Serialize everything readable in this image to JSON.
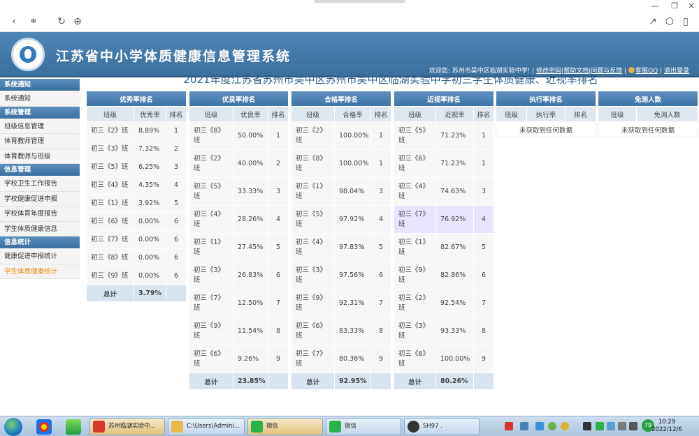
{
  "app": {
    "title": "江苏省中小学体质健康信息管理系统",
    "welcome": "欢迎您: 苏州市吴中区临湖实验中学!",
    "links": [
      "修改密码",
      "帮助文档",
      "问题与反馈",
      "客服QQ",
      "退出登录"
    ]
  },
  "sidebar": {
    "sections": [
      {
        "title": "系统通知",
        "items": [
          "系统通知"
        ]
      },
      {
        "title": "系统管理",
        "items": [
          "班级信息管理",
          "体育教师管理",
          "体育教师与班级"
        ]
      },
      {
        "title": "信息管理",
        "items": [
          "学校卫生工作报告",
          "学校健康促进申报",
          "学校体育年度报告",
          "学生体质健康信息"
        ]
      },
      {
        "title": "信息统计",
        "items": [
          "健康促进申报统计",
          "学生体质健康统计"
        ]
      }
    ],
    "active_item": "学生体质健康统计"
  },
  "page": {
    "heading": "2021年度江苏省苏州市吴中区苏州市吴中区临湖实验中学初三学生体质健康、近视率排名"
  },
  "tables": {
    "excellent": {
      "title": "优秀率排名",
      "columns": [
        "班级",
        "优秀率",
        "排名"
      ],
      "rows": [
        [
          "初三《2》班",
          "8.89%",
          "1"
        ],
        [
          "初三《3》班",
          "7.32%",
          "2"
        ],
        [
          "初三《5》班",
          "6.25%",
          "3"
        ],
        [
          "初三《4》班",
          "4.35%",
          "4"
        ],
        [
          "初三《1》班",
          "3.92%",
          "5"
        ],
        [
          "初三《6》班",
          "0.00%",
          "6"
        ],
        [
          "初三《7》班",
          "0.00%",
          "6"
        ],
        [
          "初三《8》班",
          "0.00%",
          "6"
        ],
        [
          "初三《9》班",
          "0.00%",
          "6"
        ]
      ],
      "total_label": "总计",
      "total_value": "3.79%"
    },
    "good": {
      "title": "优良率排名",
      "columns": [
        "班级",
        "优良率",
        "排名"
      ],
      "rows": [
        [
          "初三《8》班",
          "50.00%",
          "1"
        ],
        [
          "初三《2》班",
          "40.00%",
          "2"
        ],
        [
          "初三《5》班",
          "33.33%",
          "3"
        ],
        [
          "初三《4》班",
          "28.26%",
          "4"
        ],
        [
          "初三《1》班",
          "27.45%",
          "5"
        ],
        [
          "初三《3》班",
          "26.83%",
          "6"
        ],
        [
          "初三《7》班",
          "12.50%",
          "7"
        ],
        [
          "初三《9》班",
          "11.54%",
          "8"
        ],
        [
          "初三《6》班",
          "9.26%",
          "9"
        ]
      ],
      "total_label": "总计",
      "total_value": "23.85%"
    },
    "pass": {
      "title": "合格率排名",
      "columns": [
        "班级",
        "合格率",
        "排名"
      ],
      "rows": [
        [
          "初三《2》班",
          "100.00%",
          "1"
        ],
        [
          "初三《8》班",
          "100.00%",
          "1"
        ],
        [
          "初三《1》班",
          "98.04%",
          "3"
        ],
        [
          "初三《5》班",
          "97.92%",
          "4"
        ],
        [
          "初三《4》班",
          "97.83%",
          "5"
        ],
        [
          "初三《3》班",
          "97.56%",
          "6"
        ],
        [
          "初三《9》班",
          "92.31%",
          "7"
        ],
        [
          "初三《6》班",
          "83.33%",
          "8"
        ],
        [
          "初三《7》班",
          "80.36%",
          "9"
        ]
      ],
      "total_label": "总计",
      "total_value": "92.95%"
    },
    "myopia": {
      "title": "近视率排名",
      "columns": [
        "班级",
        "近视率",
        "排名"
      ],
      "rows": [
        [
          "初三《5》班",
          "71.23%",
          "1"
        ],
        [
          "初三《6》班",
          "71.23%",
          "1"
        ],
        [
          "初三《4》班",
          "74.63%",
          "3"
        ],
        [
          "初三《7》班",
          "76.92%",
          "4"
        ],
        [
          "初三《1》班",
          "82.67%",
          "5"
        ],
        [
          "初三《9》班",
          "82.86%",
          "6"
        ],
        [
          "初三《2》班",
          "92.54%",
          "7"
        ],
        [
          "初三《3》班",
          "93.33%",
          "8"
        ],
        [
          "初三《8》班",
          "100.00%",
          "9"
        ]
      ],
      "highlight_row": "4",
      "total_label": "总计",
      "total_value": "80.26%"
    },
    "exec": {
      "title": "执行率排名",
      "columns": [
        "班级",
        "执行率",
        "排名"
      ],
      "empty": "未获取到任何数据"
    },
    "exempt": {
      "title": "免测人数",
      "columns": [
        "班级",
        "免测人数"
      ],
      "empty": "未获取到任何数据"
    }
  },
  "taskbar": {
    "tasks": [
      "苏州临湖实验中...",
      "C:\\Users\\Admini...",
      "微信",
      "微信",
      "SH97 ."
    ],
    "tray_badge": "79",
    "time": "10:29",
    "date": "2022/12/6"
  }
}
